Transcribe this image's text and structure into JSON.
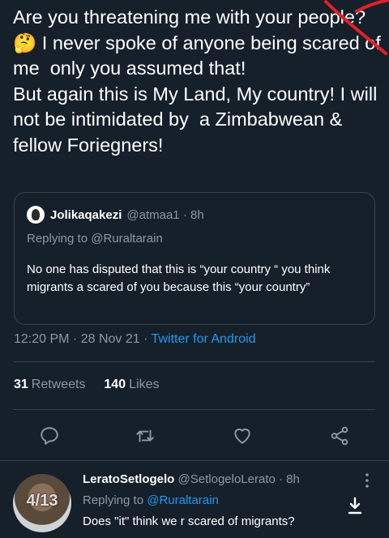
{
  "tweet": {
    "text": "Are you threatening me with your people? 🤔 I never spoke of anyone being scared of me  only you assumed that!\nBut again this is My Land, My country! I will not be intimidated by  a Zimbabwean & fellow Foriegners!"
  },
  "quoted": {
    "name": "Jolikaqakezi",
    "handle_time": "@atmaa1 · 8h",
    "replying": "Replying to @Ruraltarain",
    "text": "No one has disputed that this is “your country “ you think migrants a scared of you because this “your country”"
  },
  "meta": {
    "time": "12:20 PM · 28 Nov 21 · ",
    "app": "Twitter for Android"
  },
  "stats": {
    "retweets_count": "31",
    "retweets_label": "Retweets",
    "likes_count": "140",
    "likes_label": "Likes"
  },
  "icons": [
    "reply-icon",
    "retweet-icon",
    "like-icon",
    "share-icon",
    "more-icon",
    "download-icon"
  ],
  "reply": {
    "avatar_counter": "4/13",
    "name": "LeratoSetlogelo",
    "handle_time": "@SetlogeloLerato · 8h",
    "replying_prefix": "Replying to ",
    "replying_handle": "@Ruraltarain",
    "text": "Does \"it\" think we r scared of migrants?"
  },
  "colors": {
    "background": "#15202b",
    "accent": "#1d9bf0",
    "muted": "#8b98a5",
    "border": "#38444d",
    "annotation": "#e0202a"
  }
}
